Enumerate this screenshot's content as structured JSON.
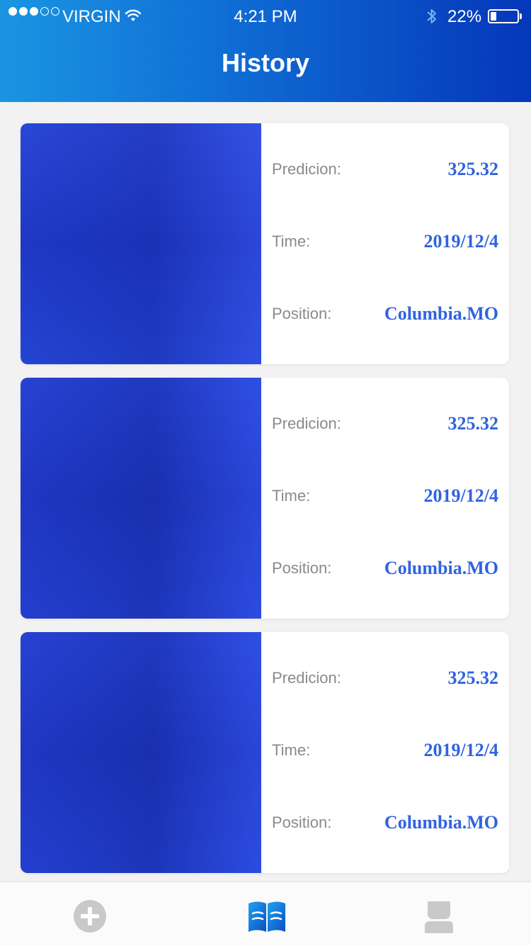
{
  "status_bar": {
    "carrier": "VIRGIN",
    "time": "4:21 PM",
    "battery_percent": "22%",
    "battery_level": 0.22,
    "signal_bars_filled": 3,
    "signal_bars_total": 5
  },
  "header": {
    "title": "History"
  },
  "history": [
    {
      "prediction_label": "Predicion:",
      "prediction_value": "325.32",
      "time_label": "Time:",
      "time_value": "2019/12/4",
      "position_label": "Position:",
      "position_value": "Columbia.MO"
    },
    {
      "prediction_label": "Predicion:",
      "prediction_value": "325.32",
      "time_label": "Time:",
      "time_value": "2019/12/4",
      "position_label": "Position:",
      "position_value": "Columbia.MO"
    },
    {
      "prediction_label": "Predicion:",
      "prediction_value": "325.32",
      "time_label": "Time:",
      "time_value": "2019/12/4",
      "position_label": "Position:",
      "position_value": "Columbia.MO"
    }
  ],
  "tab_bar": {
    "tabs": [
      {
        "icon": "add-circle-icon",
        "active": false
      },
      {
        "icon": "open-book-icon",
        "active": true
      },
      {
        "icon": "person-icon",
        "active": false
      }
    ]
  },
  "colors": {
    "header_gradient_start": "#1a95e2",
    "header_gradient_end": "#0537b9",
    "value_text": "#2f63e0",
    "label_text": "#8a8a8a",
    "tab_active": "#1e7ad8",
    "tab_inactive": "#c9c9c9"
  }
}
